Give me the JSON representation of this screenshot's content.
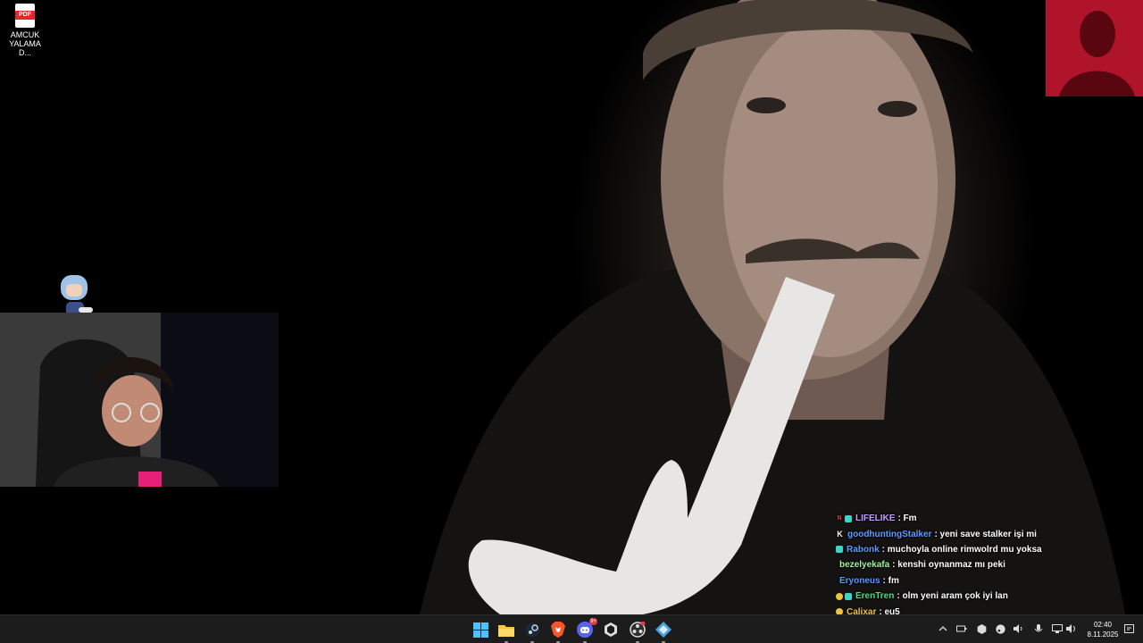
{
  "desktop": {
    "icons": [
      {
        "type_label": "PDF",
        "label": "AMCUK YALAMA D..."
      }
    ]
  },
  "chat": {
    "messages": [
      {
        "user": "LIFELIKE",
        "color": "#c59cff",
        "text": ": Fm"
      },
      {
        "user": "goodhuntingStalker",
        "color": "#5a9cff",
        "text": ": yeni save stalker işi mi"
      },
      {
        "user": "Rabonk",
        "color": "#5a9cff",
        "text": ": muchoyla online rimwolrd mu yoksa"
      },
      {
        "user": "bezelyekafa",
        "color": "#9cf59c",
        "text": ": kenshi oynanmaz mı peki"
      },
      {
        "user": "Eryoneus",
        "color": "#5a9cff",
        "text": ": fm"
      },
      {
        "user": "ErenTren",
        "color": "#3fe08a",
        "text": ": olm yeni aram çok iyi lan"
      },
      {
        "user": "Calixar",
        "color": "#f0c43a",
        "text": ": eu5"
      }
    ]
  },
  "taskbar": {
    "apps": [
      "start-icon",
      "file-explorer-icon",
      "steam-icon",
      "brave-icon",
      "discord-icon",
      "unity-icon",
      "obs-icon",
      "app-icon"
    ],
    "discord_badge": "9+",
    "clock": {
      "time": "02:40",
      "date": "8.11.2025"
    }
  }
}
